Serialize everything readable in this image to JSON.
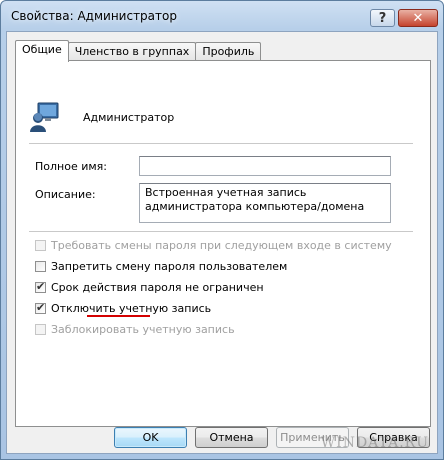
{
  "window": {
    "title": "Свойства: Администратор",
    "help_label": "?",
    "close_label": "✕"
  },
  "tabs": [
    {
      "label": "Общие",
      "active": true
    },
    {
      "label": "Членство в группах",
      "active": false
    },
    {
      "label": "Профиль",
      "active": false
    }
  ],
  "user": {
    "name": "Администратор",
    "icon": "user-account-icon"
  },
  "fields": {
    "full_name_label": "Полное имя:",
    "full_name_value": "",
    "description_label": "Описание:",
    "description_value": "Встроенная учетная запись администратора компьютера/домена"
  },
  "checkboxes": [
    {
      "label": "Требовать смены пароля при следующем входе в систему",
      "checked": false,
      "disabled": true
    },
    {
      "label": "Запретить смену пароля пользователем",
      "checked": false,
      "disabled": false
    },
    {
      "label": "Срок действия пароля не ограничен",
      "checked": true,
      "disabled": false
    },
    {
      "label": "Отключить учетную запись",
      "checked": true,
      "disabled": false
    },
    {
      "label": "Заблокировать учетную запись",
      "checked": false,
      "disabled": true
    }
  ],
  "buttons": {
    "ok": "OK",
    "cancel": "Отмена",
    "apply": "Применить",
    "help": "Справка"
  },
  "watermark": "WINDATA.RU",
  "colors": {
    "highlight_underline": "#d40000",
    "default_button": "#3c7fb1"
  }
}
